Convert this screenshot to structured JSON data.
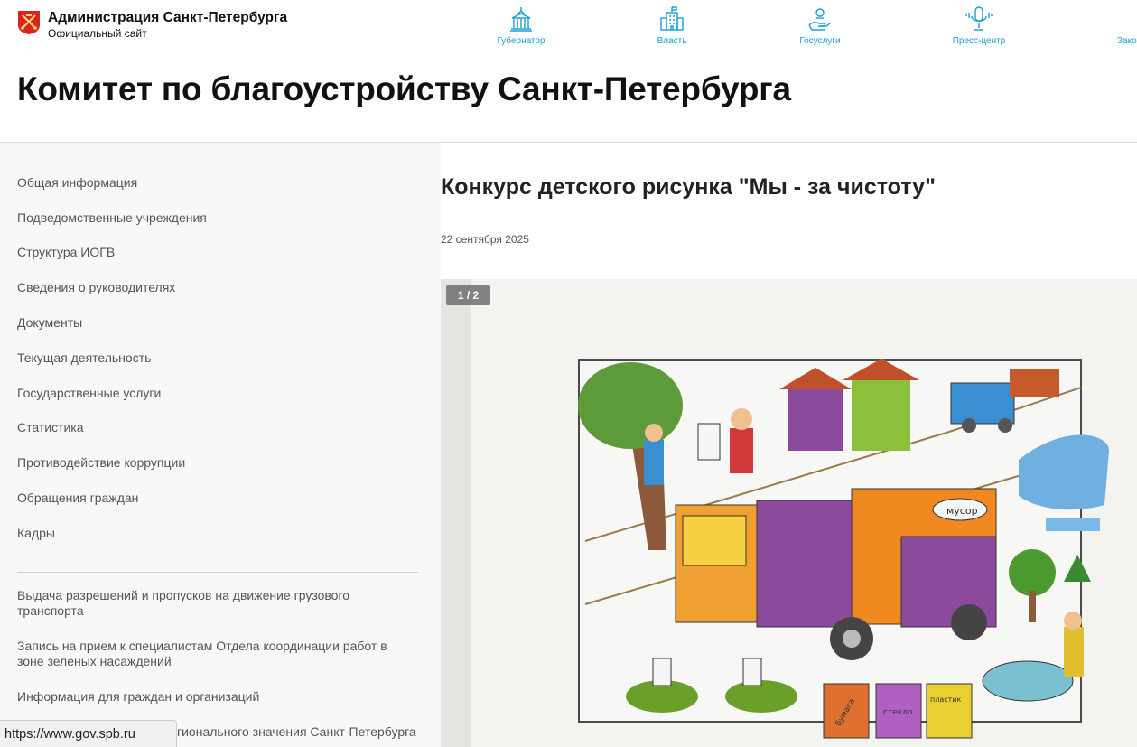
{
  "header": {
    "brand_title": "Администрация Санкт-Петербурга",
    "brand_subtitle": "Официальный сайт",
    "nav": [
      {
        "label": "Губернатор",
        "icon": "government-building-icon"
      },
      {
        "label": "Власть",
        "icon": "office-building-icon"
      },
      {
        "label": "Госуслуги",
        "icon": "hand-service-icon"
      },
      {
        "label": "Пресс-центр",
        "icon": "microphone-icon"
      },
      {
        "label": "Зако",
        "icon": "law-icon"
      }
    ],
    "accent_color": "#1a9fd6"
  },
  "page_title": "Комитет по благоустройству Санкт-Петербурга",
  "sidebar": {
    "items": [
      {
        "label": "Общая информация"
      },
      {
        "label": "Подведомственные учреждения"
      },
      {
        "label": "Структура ИОГВ"
      },
      {
        "label": "Сведения о руководителях"
      },
      {
        "label": "Документы"
      },
      {
        "label": "Текущая деятельность"
      },
      {
        "label": "Государственные услуги"
      },
      {
        "label": "Статистика"
      },
      {
        "label": "Противодействие коррупции"
      },
      {
        "label": "Обращения граждан"
      },
      {
        "label": "Кадры"
      }
    ],
    "links": [
      {
        "label": "Выдача разрешений и пропусков на движение грузового транспорта"
      },
      {
        "label": "Запись на прием к специалистам Отдела координации работ в зоне зеленых насаждений"
      },
      {
        "label": "Информация для граждан и организаций"
      },
      {
        "label": "гионального значения Санкт-Петербурга"
      }
    ]
  },
  "article": {
    "title": "Конкурс детского рисунка \"Мы - за чистоту\"",
    "date": "22 сентября 2025",
    "gallery_counter": "1 / 2",
    "drawing_labels": {
      "musor": "мусор",
      "bumaga": "бумага",
      "steklo": "стекло",
      "plastic": "пластик"
    }
  },
  "status_url": "https://www.gov.spb.ru"
}
